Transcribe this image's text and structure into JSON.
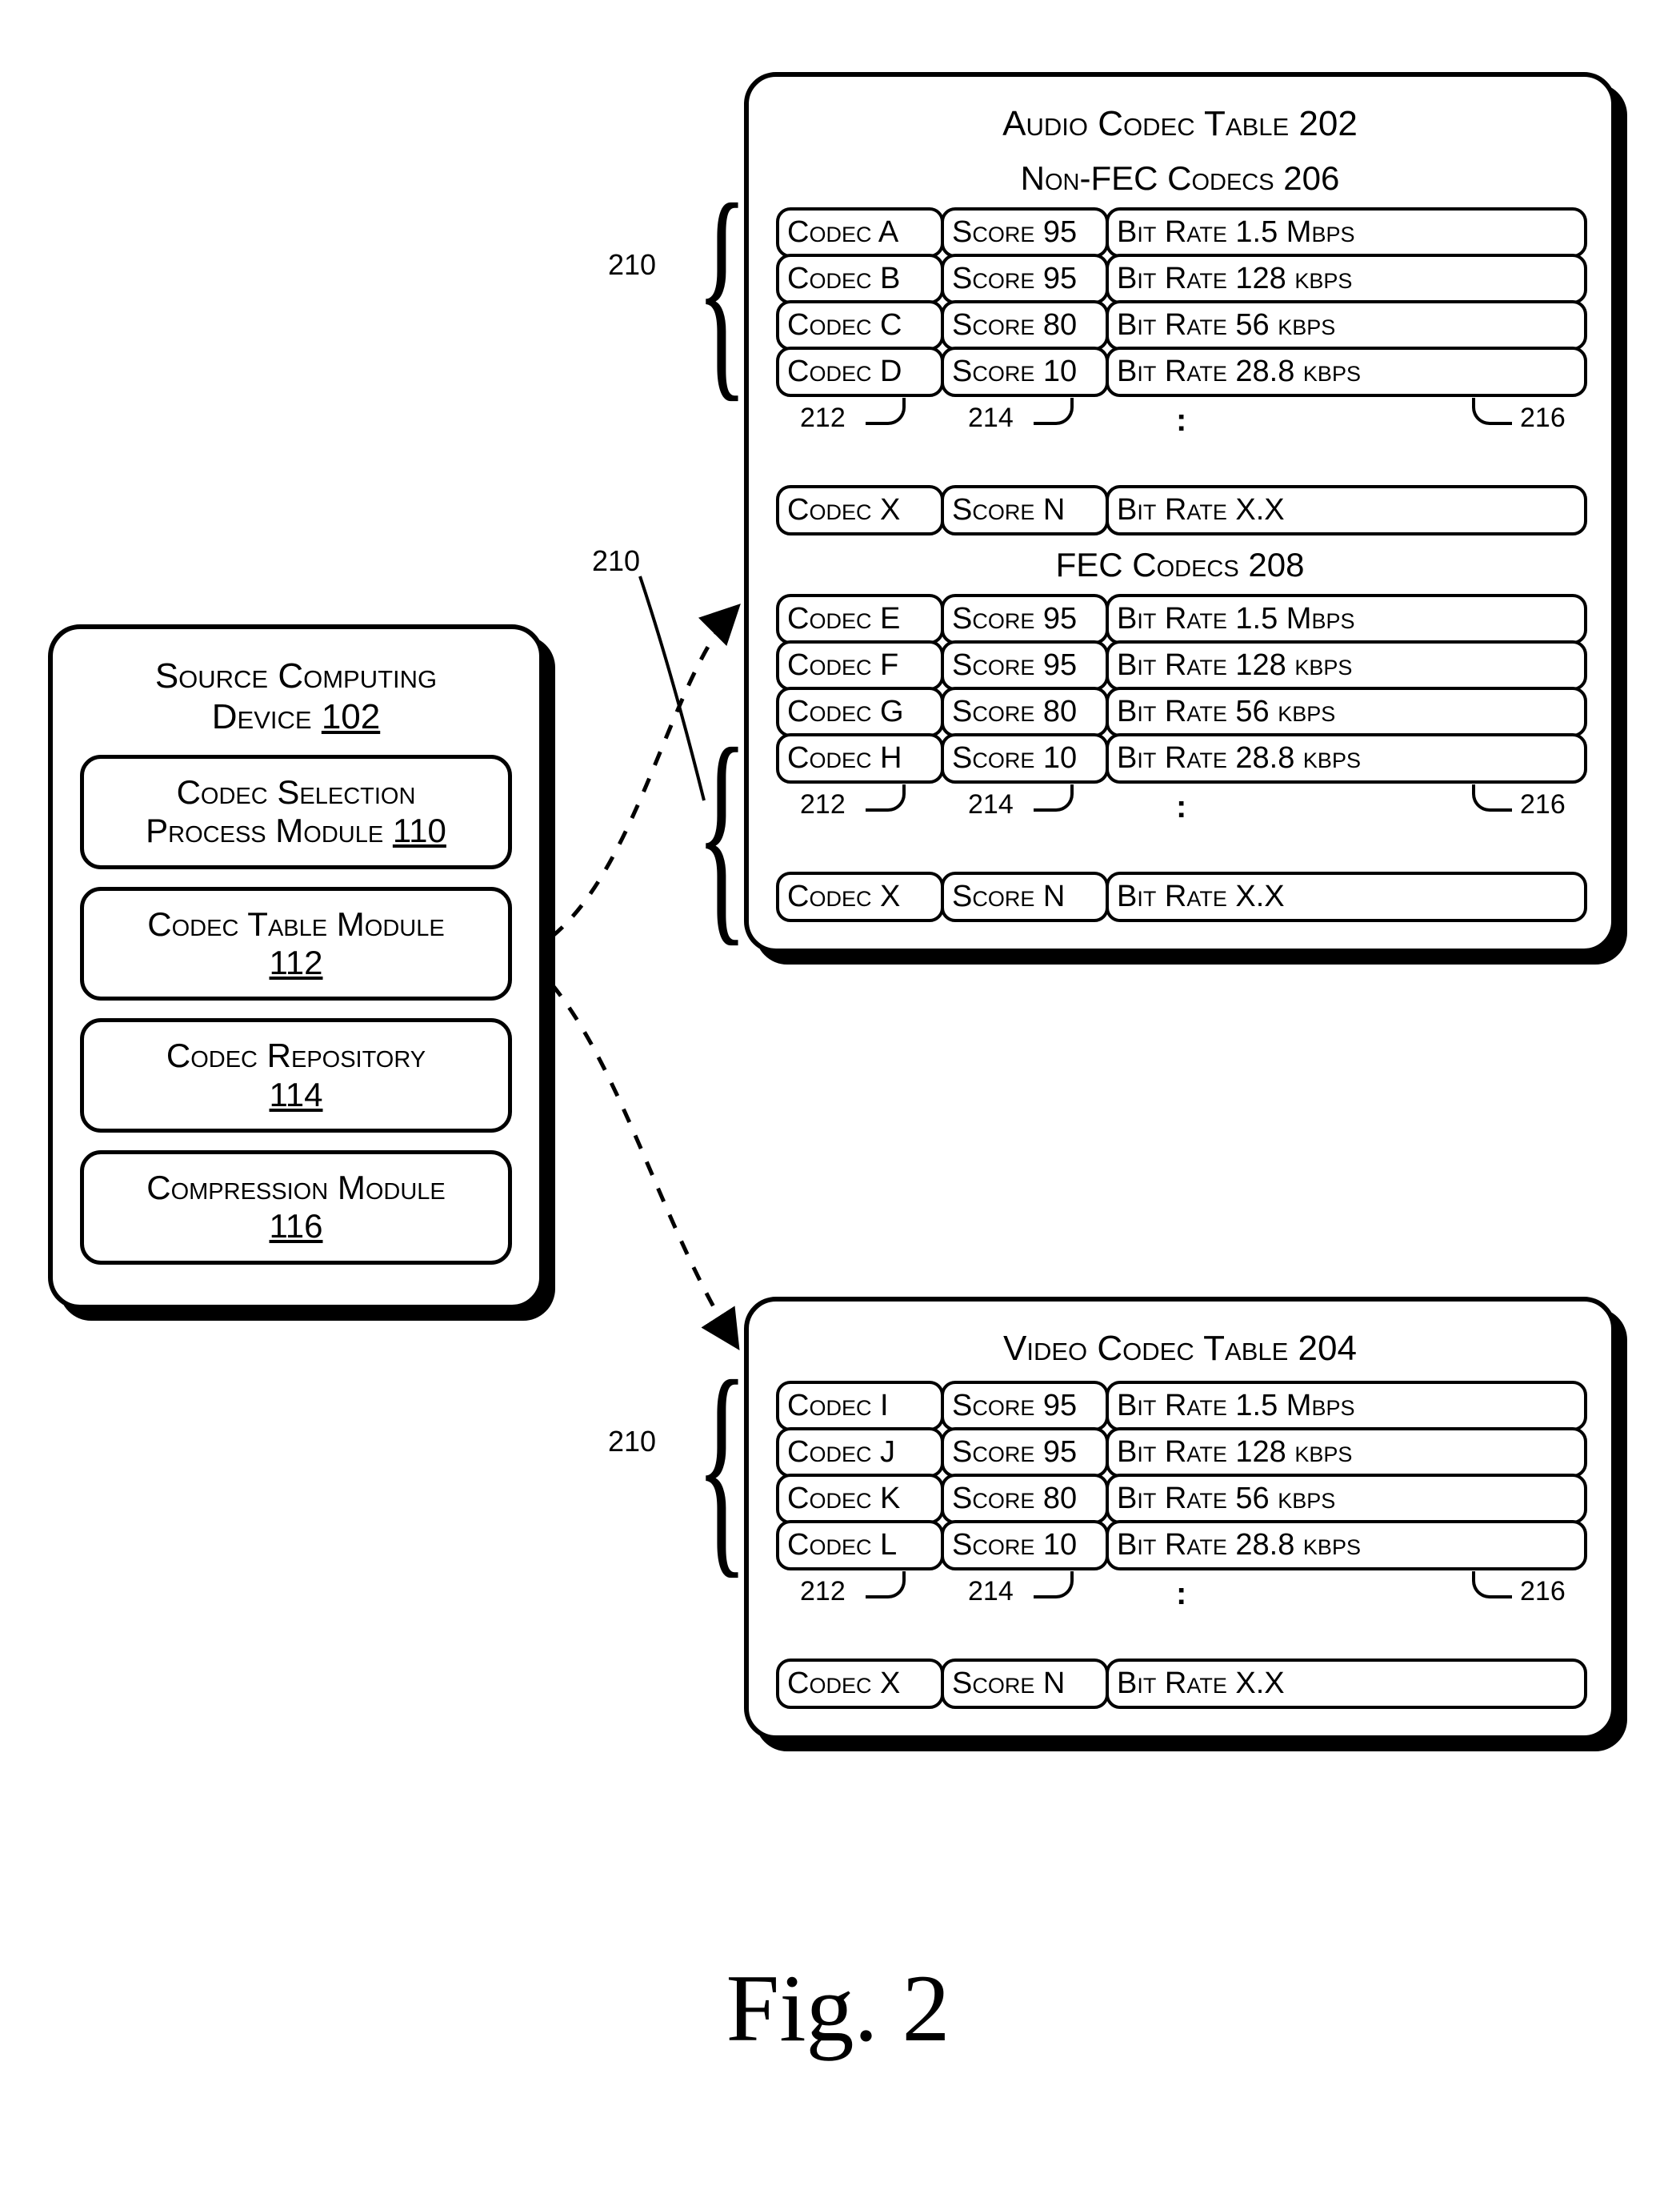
{
  "figure_caption": "Fig.  2",
  "source_device": {
    "title_line1": "Source Computing",
    "title_line2": "Device",
    "title_ref": "102",
    "modules": {
      "codec_selection_line1": "Codec Selection",
      "codec_selection_line2": "Process Module",
      "codec_selection_ref": "110",
      "codec_table": "Codec Table Module",
      "codec_table_ref": "112",
      "codec_repository": "Codec Repository",
      "codec_repository_ref": "114",
      "compression": "Compression Module",
      "compression_ref": "116"
    }
  },
  "labels": {
    "entry_210": "210",
    "col_212": "212",
    "col_214": "214",
    "col_216": "216"
  },
  "placeholder_row": {
    "codec": "Codec X",
    "score": "Score N",
    "bitrate": "Bit Rate X.X"
  },
  "audio_table": {
    "title": "Audio Codec Table 202",
    "non_fec_heading": "Non-FEC Codecs 206",
    "fec_heading": "FEC Codecs 208",
    "non_fec_rows": [
      {
        "codec": "Codec A",
        "score": "Score 95",
        "bitrate": "Bit Rate 1.5 Mbps"
      },
      {
        "codec": "Codec B",
        "score": "Score 95",
        "bitrate": "Bit Rate 128 kbps"
      },
      {
        "codec": "Codec C",
        "score": "Score 80",
        "bitrate": "Bit Rate 56 kbps"
      },
      {
        "codec": "Codec D",
        "score": "Score 10",
        "bitrate": "Bit Rate 28.8 kbps"
      }
    ],
    "fec_rows": [
      {
        "codec": "Codec E",
        "score": "Score 95",
        "bitrate": "Bit Rate 1.5 Mbps"
      },
      {
        "codec": "Codec F",
        "score": "Score 95",
        "bitrate": "Bit Rate 128 kbps"
      },
      {
        "codec": "Codec G",
        "score": "Score 80",
        "bitrate": "Bit Rate 56 kbps"
      },
      {
        "codec": "Codec H",
        "score": "Score 10",
        "bitrate": "Bit Rate 28.8 kbps"
      }
    ]
  },
  "video_table": {
    "title": "Video Codec Table 204",
    "rows": [
      {
        "codec": "Codec I",
        "score": "Score 95",
        "bitrate": "Bit Rate 1.5 Mbps"
      },
      {
        "codec": "Codec J",
        "score": "Score 95",
        "bitrate": "Bit Rate 128 kbps"
      },
      {
        "codec": "Codec K",
        "score": "Score 80",
        "bitrate": "Bit Rate 56 kbps"
      },
      {
        "codec": "Codec L",
        "score": "Score 10",
        "bitrate": "Bit Rate 28.8 kbps"
      }
    ]
  }
}
